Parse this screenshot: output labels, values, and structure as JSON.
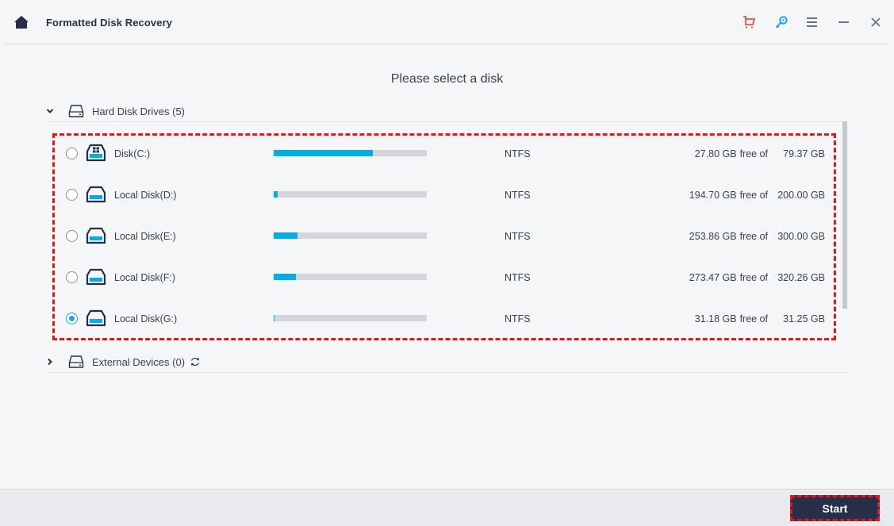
{
  "titlebar": {
    "title": "Formatted Disk Recovery",
    "icons": [
      "home-icon",
      "cart-icon",
      "key-icon",
      "menu-icon",
      "minimize-icon",
      "close-icon"
    ],
    "cart_color": "#f0504a",
    "key_color": "#1aa6e0"
  },
  "main": {
    "heading": "Please select a disk",
    "groups": [
      {
        "label": "Hard Disk Drives (5)",
        "expanded": true
      },
      {
        "label": "External Devices (0)",
        "expanded": false
      }
    ],
    "disks": [
      {
        "name": "Disk(C:)",
        "icon": "windows-disk-icon",
        "filesystem": "NTFS",
        "free": "27.80 GB",
        "free_of": "free of",
        "total": "79.37 GB",
        "used_fraction": 0.65,
        "selected": false
      },
      {
        "name": "Local Disk(D:)",
        "icon": "disk-icon",
        "filesystem": "NTFS",
        "free": "194.70 GB",
        "free_of": "free of",
        "total": "200.00 GB",
        "used_fraction": 0.027,
        "selected": false
      },
      {
        "name": "Local Disk(E:)",
        "icon": "disk-icon",
        "filesystem": "NTFS",
        "free": "253.86 GB",
        "free_of": "free of",
        "total": "300.00 GB",
        "used_fraction": 0.154,
        "selected": false
      },
      {
        "name": "Local Disk(F:)",
        "icon": "disk-icon",
        "filesystem": "NTFS",
        "free": "273.47 GB",
        "free_of": "free of",
        "total": "320.26 GB",
        "used_fraction": 0.146,
        "selected": false
      },
      {
        "name": "Local Disk(G:)",
        "icon": "disk-icon",
        "filesystem": "NTFS",
        "free": "31.18 GB",
        "free_of": "free of",
        "total": "31.25 GB",
        "used_fraction": 0.002,
        "selected": true
      }
    ]
  },
  "footer": {
    "start_label": "Start"
  },
  "colors": {
    "accent": "#00aee6",
    "button_bg": "#263149",
    "highlight": "#e8151b"
  }
}
